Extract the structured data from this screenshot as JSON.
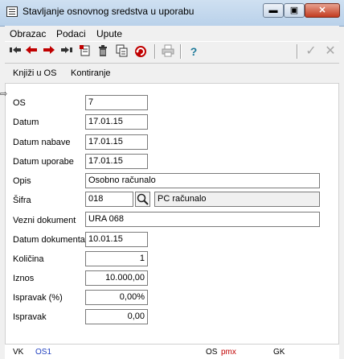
{
  "window": {
    "title": "Stavljanje osnovnog sredstva u uporabu",
    "min_label": "▬",
    "max_label": "▣",
    "close_label": "✕"
  },
  "menu": [
    "Obrazac",
    "Podaci",
    "Upute"
  ],
  "toolbar": {
    "icons": [
      "first-record-icon",
      "previous-record-icon",
      "next-record-icon",
      "last-record-icon",
      "new-record-icon",
      "delete-icon",
      "copy-icon",
      "refresh-icon",
      "print-icon",
      "help-icon",
      "confirm-icon",
      "cancel-icon"
    ],
    "help_glyph": "?",
    "confirm_glyph": "✓",
    "cancel_glyph": "✕"
  },
  "tabs": [
    "Knjiži u OS",
    "Kontiranje"
  ],
  "form": {
    "os_label": "OS",
    "os_value": "7",
    "datum_label": "Datum",
    "datum_value": "17.01.15",
    "datum_nabave_label": "Datum nabave",
    "datum_nabave_value": "17.01.15",
    "datum_uporabe_label": "Datum uporabe",
    "datum_uporabe_value": "17.01.15",
    "opis_label": "Opis",
    "opis_value": "Osobno računalo",
    "sifra_label": "Šifra",
    "sifra_value": "018",
    "sifra_desc": "PC računalo",
    "vezni_label": "Vezni dokument",
    "vezni_value": "URA 068",
    "datum_dok_label": "Datum dokumenta",
    "datum_dok_value": "10.01.15",
    "kolicina_label": "Količina",
    "kolicina_value": "1",
    "iznos_label": "Iznos",
    "iznos_value": "10.000,00",
    "ispravak_pct_label": "Ispravak (%)",
    "ispravak_pct_value": "0,00%",
    "ispravak_label": "Ispravak",
    "ispravak_value": "0,00"
  },
  "status": {
    "vk_label": "VK",
    "vk_value": "OS1",
    "os_label": "OS",
    "os_value": "pmx",
    "gk_label": "GK"
  },
  "colors": {
    "link_blue": "#1f3fbf",
    "red": "#c00000"
  }
}
